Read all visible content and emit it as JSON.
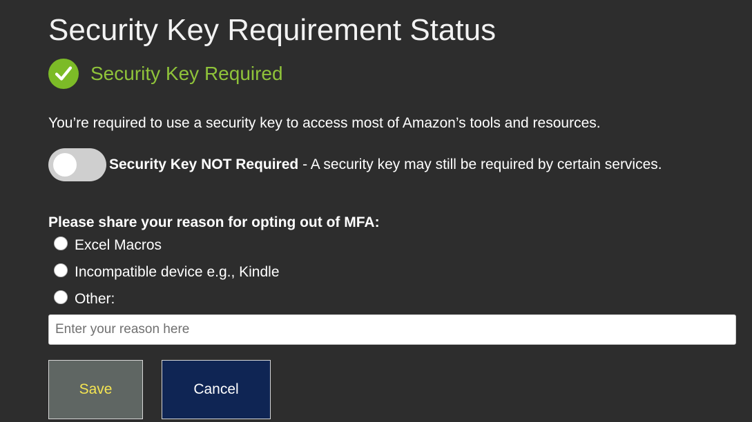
{
  "page": {
    "title": "Security Key Requirement Status"
  },
  "status": {
    "icon": "check-circle-icon",
    "text": "Security Key Required",
    "color": "#7cbb27"
  },
  "description": "You’re required to use a security key to access most of Amazon’s tools and resources.",
  "toggle": {
    "state": "off",
    "label_bold": "Security Key NOT Required",
    "label_rest": " - A security key may still be required by certain services."
  },
  "reason": {
    "heading": "Please share your reason for opting out of MFA:",
    "options": [
      {
        "label": "Excel Macros",
        "selected": false
      },
      {
        "label": "Incompatible device e.g., Kindle",
        "selected": false
      },
      {
        "label": "Other:",
        "selected": false
      }
    ],
    "input_value": "",
    "input_placeholder": "Enter your reason here"
  },
  "actions": {
    "save_label": "Save",
    "cancel_label": "Cancel"
  },
  "colors": {
    "background": "#2d2d2d",
    "save_text": "#f5e552",
    "cancel_background": "#0f2554"
  }
}
